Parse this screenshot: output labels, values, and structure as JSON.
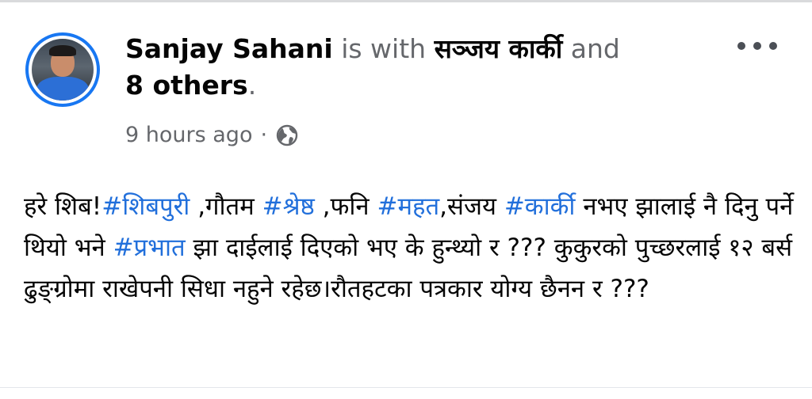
{
  "post": {
    "author": "Sanjay Sahani",
    "with_text": "is with",
    "tagged_person": "सञ्जय कार्की",
    "and_text": "and",
    "others_text": "8 others",
    "period": ".",
    "timestamp": "9 hours ago",
    "separator": "·",
    "privacy_icon": "globe-icon",
    "more_icon": "more-options-icon",
    "body": {
      "t1": "हरे शिब!",
      "h1": "#शिबपुरी",
      "t2": " ,गौतम ",
      "h2": "#श्रेष्ठ",
      "t3": " ,फनि ",
      "h3": "#महत",
      "t4": ",संजय ",
      "h4": "#कार्की",
      "t5": " नभए झालाई नै दिनु पर्ने थियो भने ",
      "h5": "#प्रभात",
      "t6": " झा दाईलाई दिएको भए के हुन्थ्यो र ??? कुकुरको पुच्छरलाई १२ बर्स ढुङ्ग्रोमा राखेपनी सिधा नहुने रहेछ।रौतहटका पत्रकार योग्य छैनन र ???"
    }
  },
  "colors": {
    "link": "#216fdb",
    "meta_text": "#65676b",
    "avatar_ring": "#1877f2",
    "text": "#050505"
  }
}
